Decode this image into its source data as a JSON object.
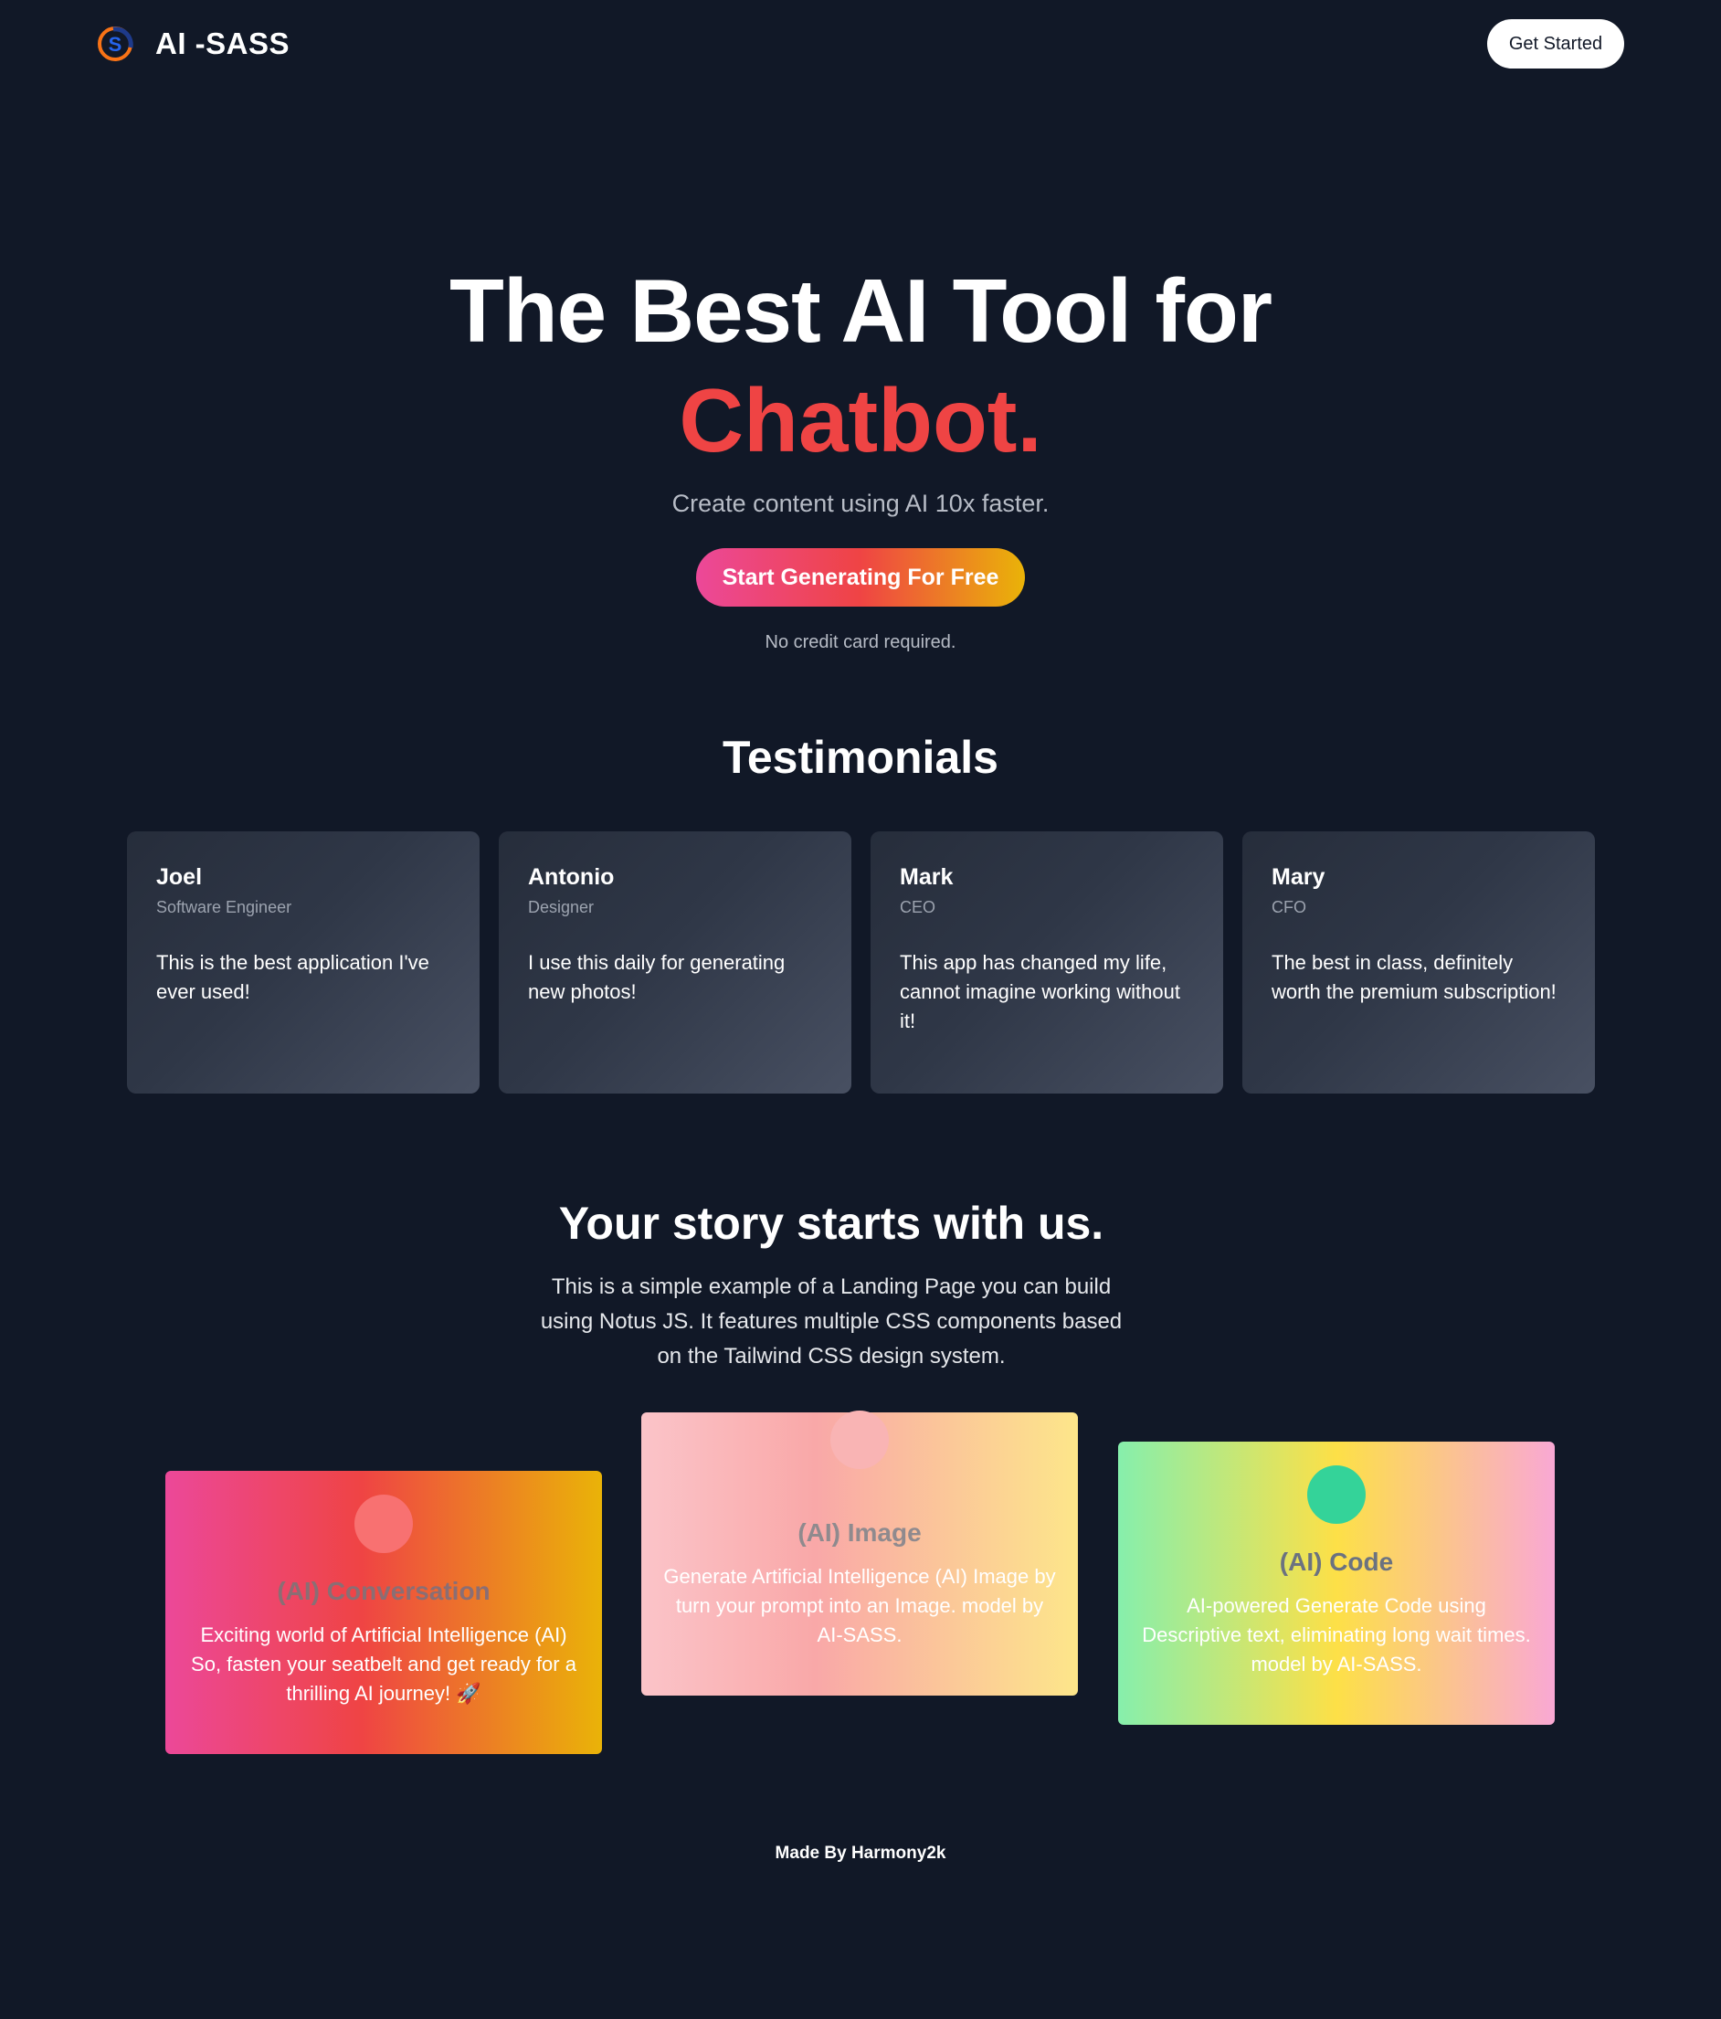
{
  "nav": {
    "brand": "AI -SASS",
    "logo_icon": "s-logo-icon",
    "cta_label": "Get Started"
  },
  "hero": {
    "title": "The Best AI Tool for",
    "accent": "Chatbot.",
    "subtitle": "Create content using AI 10x faster.",
    "cta_label": "Start Generating For Free",
    "note": "No credit card required."
  },
  "testimonials": {
    "title": "Testimonials",
    "items": [
      {
        "name": "Joel",
        "role": "Software Engineer",
        "quote": "This is the best application I've ever used!"
      },
      {
        "name": "Antonio",
        "role": "Designer",
        "quote": "I use this daily for generating new photos!"
      },
      {
        "name": "Mark",
        "role": "CEO",
        "quote": "This app has changed my life, cannot imagine working without it!"
      },
      {
        "name": "Mary",
        "role": "CFO",
        "quote": "The best in class, definitely worth the premium subscription!"
      }
    ]
  },
  "story": {
    "title": "Your story starts with us.",
    "text": "This is a simple example of a Landing Page you can build using Notus JS. It features multiple CSS components based on the Tailwind CSS design system."
  },
  "features": [
    {
      "title": "(AI) Conversation",
      "description": "Exciting world of Artificial Intelligence (AI) So, fasten your seatbelt and get ready for a thrilling AI journey! 🚀"
    },
    {
      "title": "(AI) Image",
      "description": "Generate Artificial Intelligence (AI) Image by turn your prompt into an Image. model by AI-SASS."
    },
    {
      "title": "(AI) Code",
      "description": "AI-powered Generate Code using Descriptive text, eliminating long wait times. model by AI-SASS."
    }
  ],
  "footer": {
    "text": "Made By Harmony2k"
  },
  "colors": {
    "background": "#111827",
    "accent": "#ef4444",
    "cta_gradient": [
      "#ec4899",
      "#ef4444",
      "#eab308"
    ]
  }
}
